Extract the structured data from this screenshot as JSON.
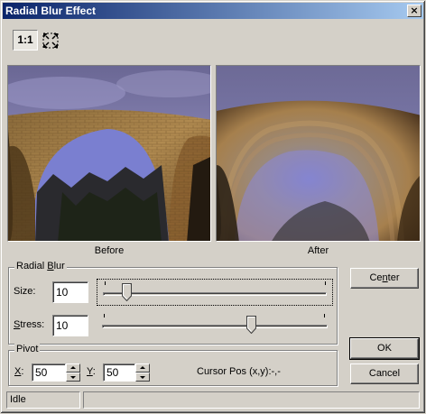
{
  "window": {
    "title": "Radial Blur Effect",
    "close_glyph": "×"
  },
  "toolbar": {
    "zoom_1to1_label": "1:1",
    "fit_icon": "fit-to-window-icon"
  },
  "preview": {
    "before_label": "Before",
    "after_label": "After"
  },
  "radial_blur": {
    "group_label_pre": "Radial ",
    "group_label_accel": "B",
    "group_label_post": "lur",
    "size_label": "Size:",
    "size_value": "10",
    "size_fraction": 0.1,
    "stress_accel": "S",
    "stress_label_rest": "tress:",
    "stress_value": "10",
    "stress_fraction": 0.67
  },
  "pivot": {
    "group_label": "Pivot",
    "x_accel": "X",
    "x_rest": ":",
    "x_value": "50",
    "y_accel": "Y",
    "y_rest": ":",
    "y_value": "50",
    "cursor_pos_text": "Cursor Pos (x,y):-,-"
  },
  "buttons": {
    "center_pre": "Ce",
    "center_accel": "n",
    "center_post": "ter",
    "ok": "OK",
    "cancel": "Cancel"
  },
  "status": {
    "text": "Idle",
    "right_text": ""
  },
  "colors": {
    "title_start": "#0a246a",
    "title_end": "#a6caf0",
    "face": "#d4d0c8"
  }
}
